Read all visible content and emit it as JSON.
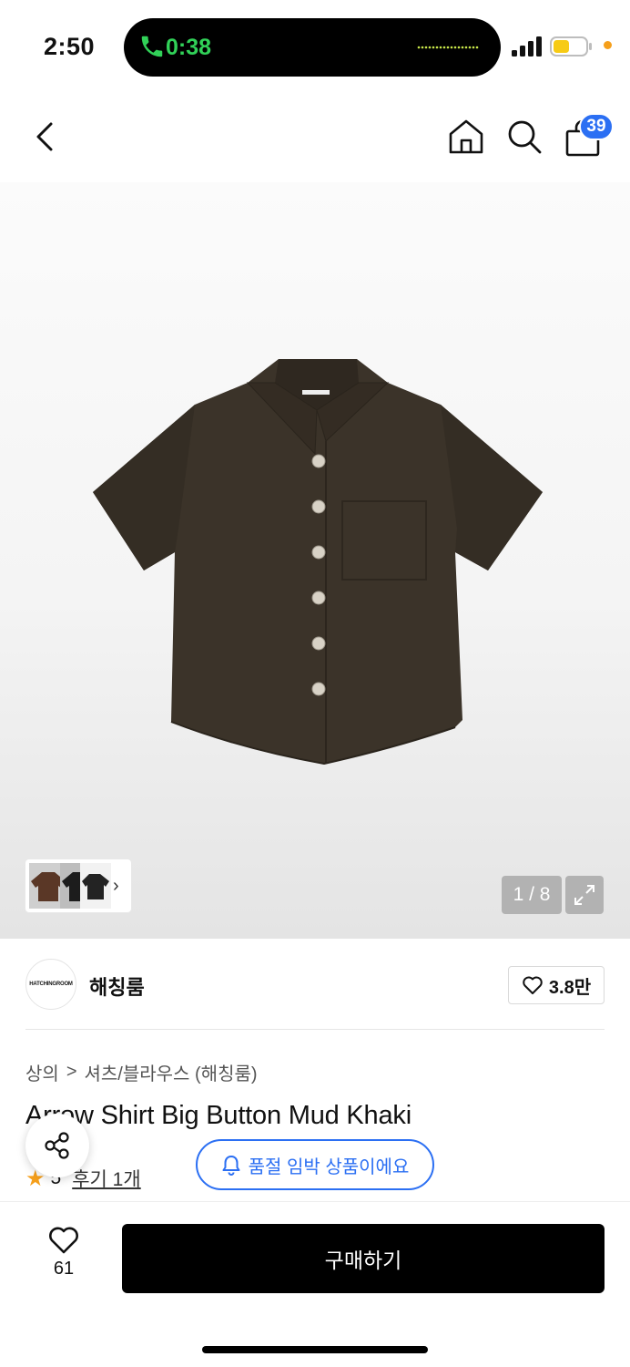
{
  "status_bar": {
    "time": "2:50",
    "call_timer": "0:38"
  },
  "nav": {
    "cart_count": "39"
  },
  "gallery": {
    "counter": "1 / 8",
    "thumbnail_chevron": "›"
  },
  "brand": {
    "logo_text": "HATCHINGROOM",
    "name": "해칭룸",
    "likes": "3.8만"
  },
  "breadcrumb": {
    "category": "상의",
    "separator": ">",
    "subcategory": "셔츠/블라우스 (해칭룸)"
  },
  "product": {
    "title": "Arrow Shirt Big Button Mud Khaki",
    "rating": "5",
    "reviews_label": "후기 1개"
  },
  "notice": {
    "soldout_label": "품절 임박 상품이에요"
  },
  "bottom_bar": {
    "wish_count": "61",
    "buy_label": "구매하기"
  },
  "colors": {
    "accent_blue": "#2b6ff3",
    "call_green": "#31d158",
    "star_orange": "#f59f1b",
    "shirt_color": "#3b3329"
  },
  "icons": [
    "back-arrow-icon",
    "home-icon",
    "search-icon",
    "shopping-bag-icon",
    "expand-icon",
    "heart-icon",
    "share-icon",
    "bell-icon",
    "star-icon",
    "phone-icon"
  ]
}
